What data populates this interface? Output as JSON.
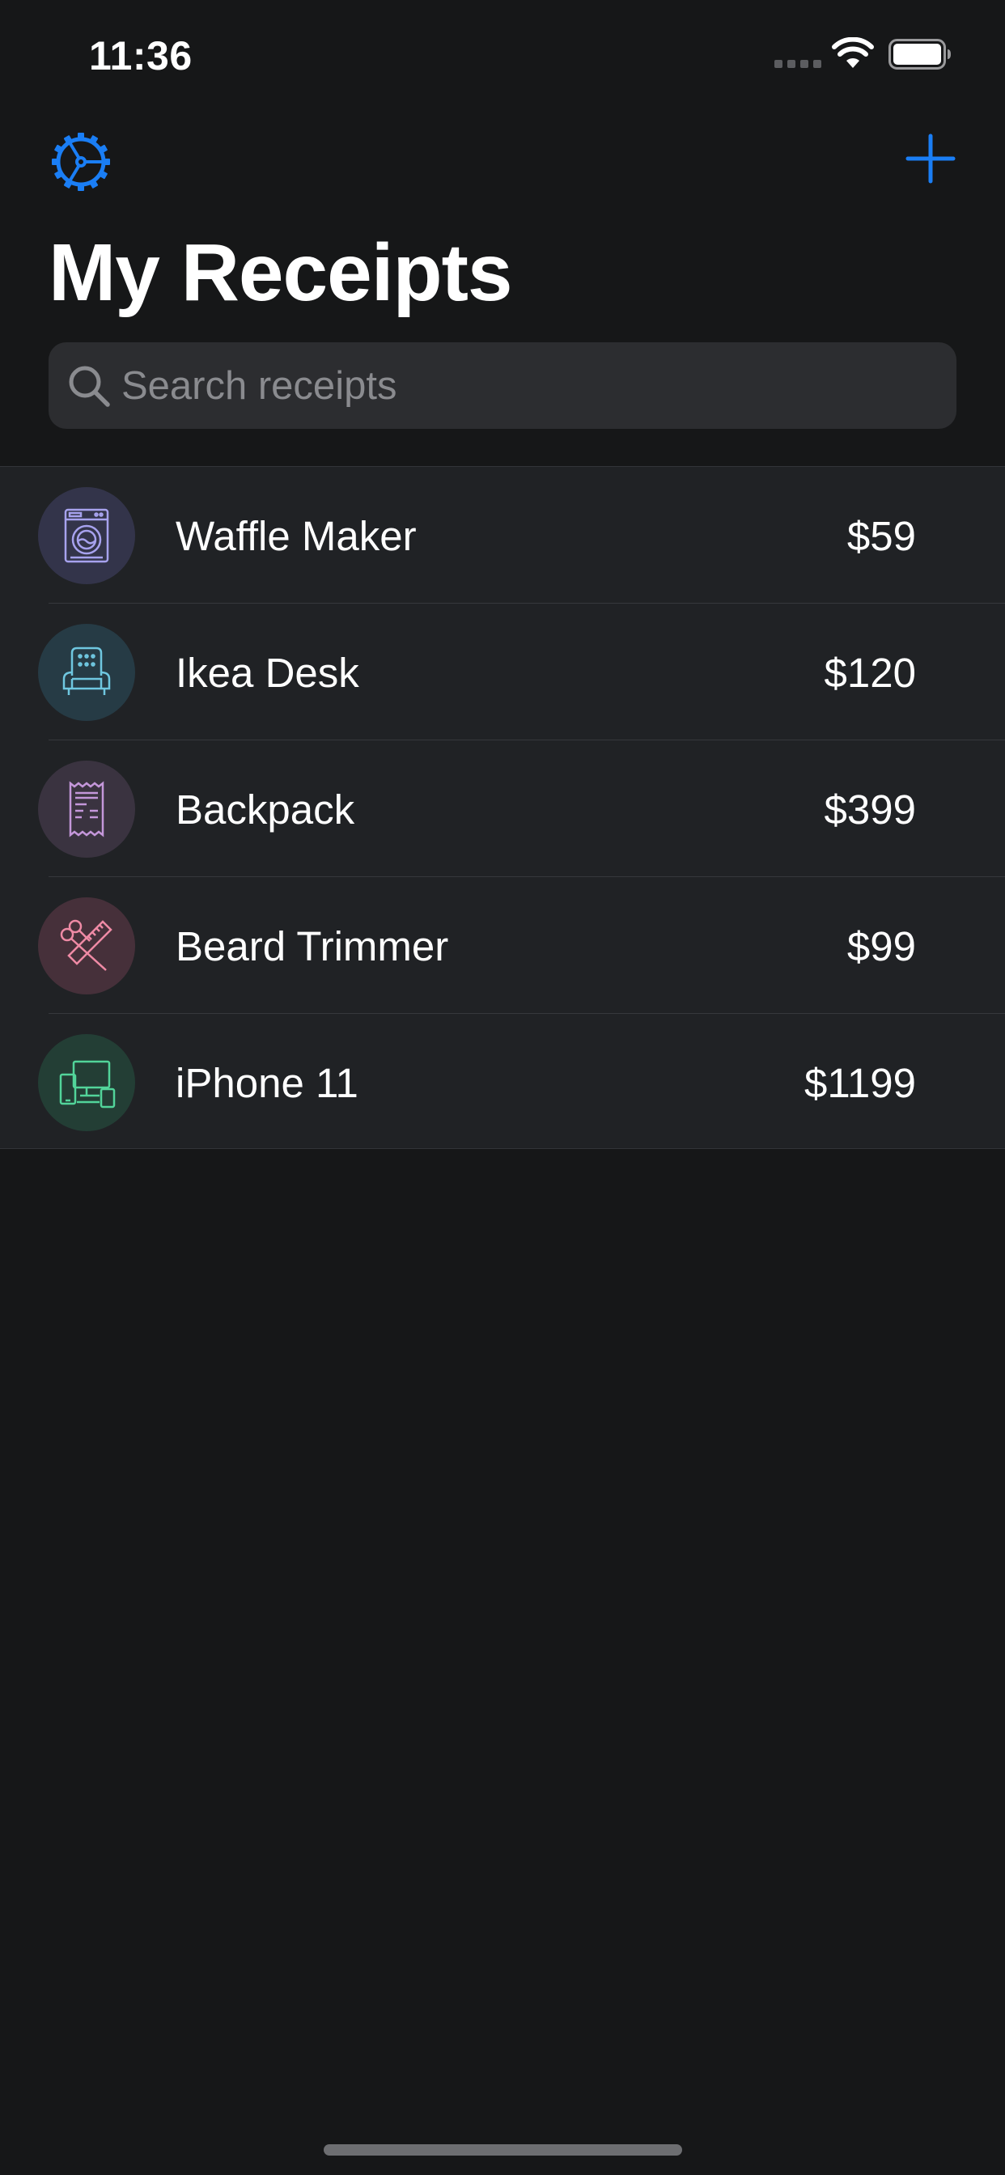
{
  "status_bar": {
    "time": "11:36",
    "signal_icon": "cellular-signal-icon",
    "wifi_icon": "wifi-icon",
    "battery_icon": "battery-icon"
  },
  "nav": {
    "settings_icon": "gear-icon",
    "add_icon": "plus-icon",
    "accent_color": "#1a7ef5"
  },
  "title": "My Receipts",
  "search": {
    "placeholder": "Search receipts",
    "value": "",
    "icon": "search-icon"
  },
  "receipts": [
    {
      "name": "Waffle Maker",
      "price": "$59",
      "icon": "washing-machine-icon",
      "icon_color": "#a7a2ee",
      "avatar_bg": "#33344a"
    },
    {
      "name": "Ikea Desk",
      "price": "$120",
      "icon": "armchair-icon",
      "icon_color": "#6fc7e0",
      "avatar_bg": "#263b45"
    },
    {
      "name": "Backpack",
      "price": "$399",
      "icon": "receipt-icon",
      "icon_color": "#c497da",
      "avatar_bg": "#3a3340"
    },
    {
      "name": "Beard Trimmer",
      "price": "$99",
      "icon": "scissors-comb-icon",
      "icon_color": "#ef8aa5",
      "avatar_bg": "#46303a"
    },
    {
      "name": "iPhone 11",
      "price": "$1199",
      "icon": "devices-icon",
      "icon_color": "#52d49a",
      "avatar_bg": "#233e35"
    }
  ]
}
